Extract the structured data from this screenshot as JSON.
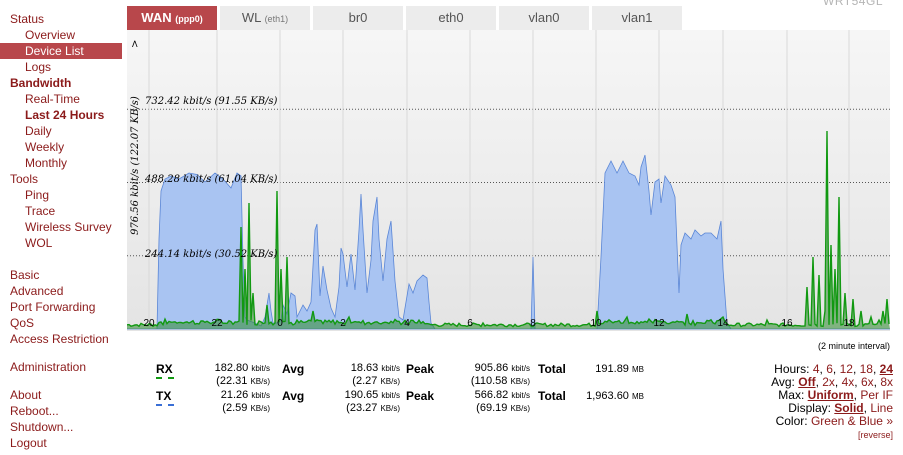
{
  "router_name": "WRT54GL",
  "sidebar": {
    "status": "Status",
    "overview": "Overview",
    "device_list": "Device List",
    "logs": "Logs",
    "bandwidth": "Bandwidth",
    "real_time": "Real-Time",
    "last_24_hours": "Last 24 Hours",
    "daily": "Daily",
    "weekly": "Weekly",
    "monthly": "Monthly",
    "tools": "Tools",
    "ping": "Ping",
    "trace": "Trace",
    "wireless_survey": "Wireless Survey",
    "wol": "WOL",
    "basic": "Basic",
    "advanced": "Advanced",
    "port_forwarding": "Port Forwarding",
    "qos": "QoS",
    "access_restriction": "Access Restriction",
    "administration": "Administration",
    "about": "About",
    "reboot": "Reboot...",
    "shutdown": "Shutdown...",
    "logout": "Logout"
  },
  "tabs": [
    {
      "label": "WAN",
      "sub": "(ppp0)"
    },
    {
      "label": "WL",
      "sub": "(eth1)"
    },
    {
      "label": "br0",
      "sub": ""
    },
    {
      "label": "eth0",
      "sub": ""
    },
    {
      "label": "vlan0",
      "sub": ""
    },
    {
      "label": "vlan1",
      "sub": ""
    }
  ],
  "graph": {
    "top_label": "976.56 kbit/s (122.07 KB/s)",
    "top_arrow": ">",
    "scale_labels": [
      "732.42 kbit/s (91.55 KB/s)",
      "488.28 kbit/s (61.04 KB/s)",
      "244.14 kbit/s (30.52 KB/s)"
    ],
    "hour_labels": [
      "20",
      "22",
      "0",
      "2",
      "4",
      "6",
      "8",
      "10",
      "12",
      "14",
      "16",
      "18"
    ],
    "interval": "(2 minute interval)",
    "colors": {
      "rx_fill": "#a9c4f2",
      "rx_line": "#5a86d6",
      "tx_line": "#119911",
      "tx_fill": "#2e8b2e",
      "grid": "#555555"
    }
  },
  "chart_data": {
    "type": "area",
    "title": "",
    "xlabel": "",
    "ylabel": "976.56 kbit/s (122.07 KB/s)",
    "x": [
      "20:00",
      "22:00",
      "00:00",
      "02:00",
      "04:00",
      "06:00",
      "08:00",
      "10:00",
      "12:00",
      "14:00",
      "16:00",
      "18:00"
    ],
    "ylim": [
      0,
      976.56
    ],
    "y_unit": "kbit/s",
    "grid": true,
    "series": [
      {
        "name": "RX",
        "color": "#a9c4f2",
        "values": [
          0,
          520,
          570,
          0,
          260,
          150,
          0,
          0,
          0,
          0,
          590,
          570,
          330,
          0,
          0,
          0
        ]
      },
      {
        "name": "TX",
        "color": "#119911",
        "values": [
          0,
          15,
          20,
          10,
          10,
          5,
          0,
          0,
          0,
          0,
          20,
          20,
          10,
          0,
          120,
          20
        ]
      }
    ]
  },
  "stats": {
    "rx": {
      "label": "RX",
      "cur": "182.80",
      "cur_unit": "kbit/s",
      "cur_b": "(22.31",
      "cur_b_unit": "KB/s)",
      "avg_label": "Avg",
      "avg": "18.63",
      "avg_unit": "kbit/s",
      "avg_b": "(2.27",
      "avg_b_unit": "KB/s)",
      "peak_label": "Peak",
      "peak": "905.86",
      "peak_unit": "kbit/s",
      "peak_b": "(110.58",
      "peak_b_unit": "KB/s)",
      "total_label": "Total",
      "total": "191.89",
      "total_unit": "MB"
    },
    "tx": {
      "label": "TX",
      "cur": "21.26",
      "cur_unit": "kbit/s",
      "cur_b": "(2.59",
      "cur_b_unit": "KB/s)",
      "avg_label": "Avg",
      "avg": "190.65",
      "avg_unit": "kbit/s",
      "avg_b": "(23.27",
      "avg_b_unit": "KB/s)",
      "peak_label": "Peak",
      "peak": "566.82",
      "peak_unit": "kbit/s",
      "peak_b": "(69.19",
      "peak_b_unit": "KB/s)",
      "total_label": "Total",
      "total": "1,963.60",
      "total_unit": "MB"
    }
  },
  "controls": {
    "hours_label": "Hours:",
    "hours": [
      "4",
      "6",
      "12",
      "18",
      "24"
    ],
    "avg_label": "Avg:",
    "avg": [
      "Off",
      "2x",
      "4x",
      "6x",
      "8x"
    ],
    "max_label": "Max:",
    "max": [
      "Uniform",
      "Per IF"
    ],
    "display_label": "Display:",
    "display": [
      "Solid",
      "Line"
    ],
    "color_label": "Color:",
    "color": "Green & Blue »",
    "reverse": "[reverse]"
  }
}
